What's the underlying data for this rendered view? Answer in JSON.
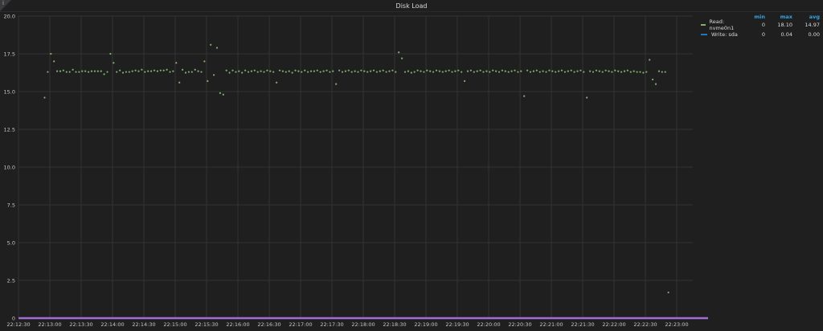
{
  "panel": {
    "title": "Disk Load",
    "info_icon": "i"
  },
  "legend": {
    "headers": {
      "min": "min",
      "max": "max",
      "avg": "avg"
    },
    "rows": [
      {
        "name": "Read: nvme0n1",
        "color": "#7eb26d",
        "min": "0",
        "max": "18.10",
        "avg": "14.97"
      },
      {
        "name": "Write: sda",
        "color": "#1f78c1",
        "min": "0",
        "max": "0.04",
        "avg": "0.00"
      }
    ]
  },
  "chart_data": {
    "type": "scatter",
    "title": "Disk Load",
    "ylim": [
      0,
      20
    ],
    "y_ticks": [
      "0",
      "2.5",
      "5.0",
      "7.5",
      "10.0",
      "12.5",
      "15.0",
      "17.5",
      "20.0"
    ],
    "x_ticks": [
      "22:12:30",
      "22:13:00",
      "22:13:30",
      "22:14:00",
      "22:14:30",
      "22:15:00",
      "22:15:30",
      "22:16:00",
      "22:16:30",
      "22:17:00",
      "22:17:30",
      "22:18:00",
      "22:18:30",
      "22:19:00",
      "22:19:30",
      "22:20:00",
      "22:20:30",
      "22:21:00",
      "22:21:30",
      "22:22:00",
      "22:22:30",
      "22:23:00"
    ],
    "xlim": [
      "22:12:30",
      "22:23:30"
    ],
    "grid": true,
    "legend": "right",
    "series": [
      {
        "name": "Read: nvme0n1",
        "color": "#7eb26d",
        "start": "22:12:55",
        "interval_s": 3,
        "values": [
          14.6,
          16.3,
          17.5,
          17.0,
          16.35,
          16.35,
          16.4,
          16.3,
          16.3,
          16.45,
          16.3,
          16.3,
          16.35,
          16.35,
          16.3,
          16.35,
          16.35,
          16.35,
          16.35,
          16.15,
          16.3,
          17.5,
          16.9,
          16.3,
          16.4,
          16.25,
          16.3,
          16.3,
          16.35,
          16.4,
          16.35,
          16.45,
          16.3,
          16.35,
          16.35,
          16.4,
          16.35,
          16.4,
          16.4,
          16.45,
          16.3,
          16.35,
          16.9,
          15.6,
          16.45,
          16.25,
          16.3,
          16.3,
          16.45,
          16.35,
          16.3,
          17.0,
          15.7,
          18.1,
          16.1,
          17.9,
          14.9,
          14.8,
          16.4,
          16.25,
          16.4,
          16.3,
          16.35,
          16.25,
          16.4,
          16.3,
          16.35,
          16.4,
          16.3,
          16.35,
          16.3,
          16.4,
          16.35,
          16.3,
          15.6,
          16.4,
          16.35,
          16.3,
          16.35,
          16.25,
          16.4,
          16.35,
          16.3,
          16.4,
          16.3,
          16.35,
          16.35,
          16.4,
          16.3,
          16.35,
          16.4,
          16.3,
          16.35,
          15.5,
          16.4,
          16.3,
          16.35,
          16.4,
          16.3,
          16.35,
          16.3,
          16.4,
          16.35,
          16.3,
          16.35,
          16.4,
          16.3,
          16.35,
          16.4,
          16.3,
          16.35,
          16.4,
          16.3,
          17.6,
          17.2,
          16.3,
          16.35,
          16.25,
          16.3,
          16.4,
          16.35,
          16.3,
          16.4,
          16.35,
          16.3,
          16.4,
          16.35,
          16.3,
          16.35,
          16.4,
          16.3,
          16.35,
          16.4,
          16.3,
          15.7,
          16.35,
          16.4,
          16.3,
          16.35,
          16.4,
          16.3,
          16.35,
          16.3,
          16.4,
          16.35,
          16.3,
          16.4,
          16.35,
          16.3,
          16.35,
          16.4,
          16.3,
          16.35,
          14.7,
          16.4,
          16.3,
          16.35,
          16.4,
          16.3,
          16.35,
          16.3,
          16.4,
          16.35,
          16.3,
          16.35,
          16.4,
          16.3,
          16.35,
          16.4,
          16.3,
          16.35,
          16.4,
          16.3,
          14.6,
          16.35,
          16.3,
          16.4,
          16.35,
          16.3,
          16.4,
          16.35,
          16.3,
          16.4,
          16.35,
          16.3,
          16.35,
          16.4,
          16.3,
          16.35,
          16.3,
          16.3,
          16.25,
          16.3,
          17.1,
          15.8,
          15.5,
          16.35,
          16.3,
          16.3,
          1.7
        ]
      },
      {
        "name": "Write: sda",
        "color": "#a36bd6",
        "start": "22:12:30",
        "end": "22:23:30",
        "value": 0
      }
    ]
  }
}
